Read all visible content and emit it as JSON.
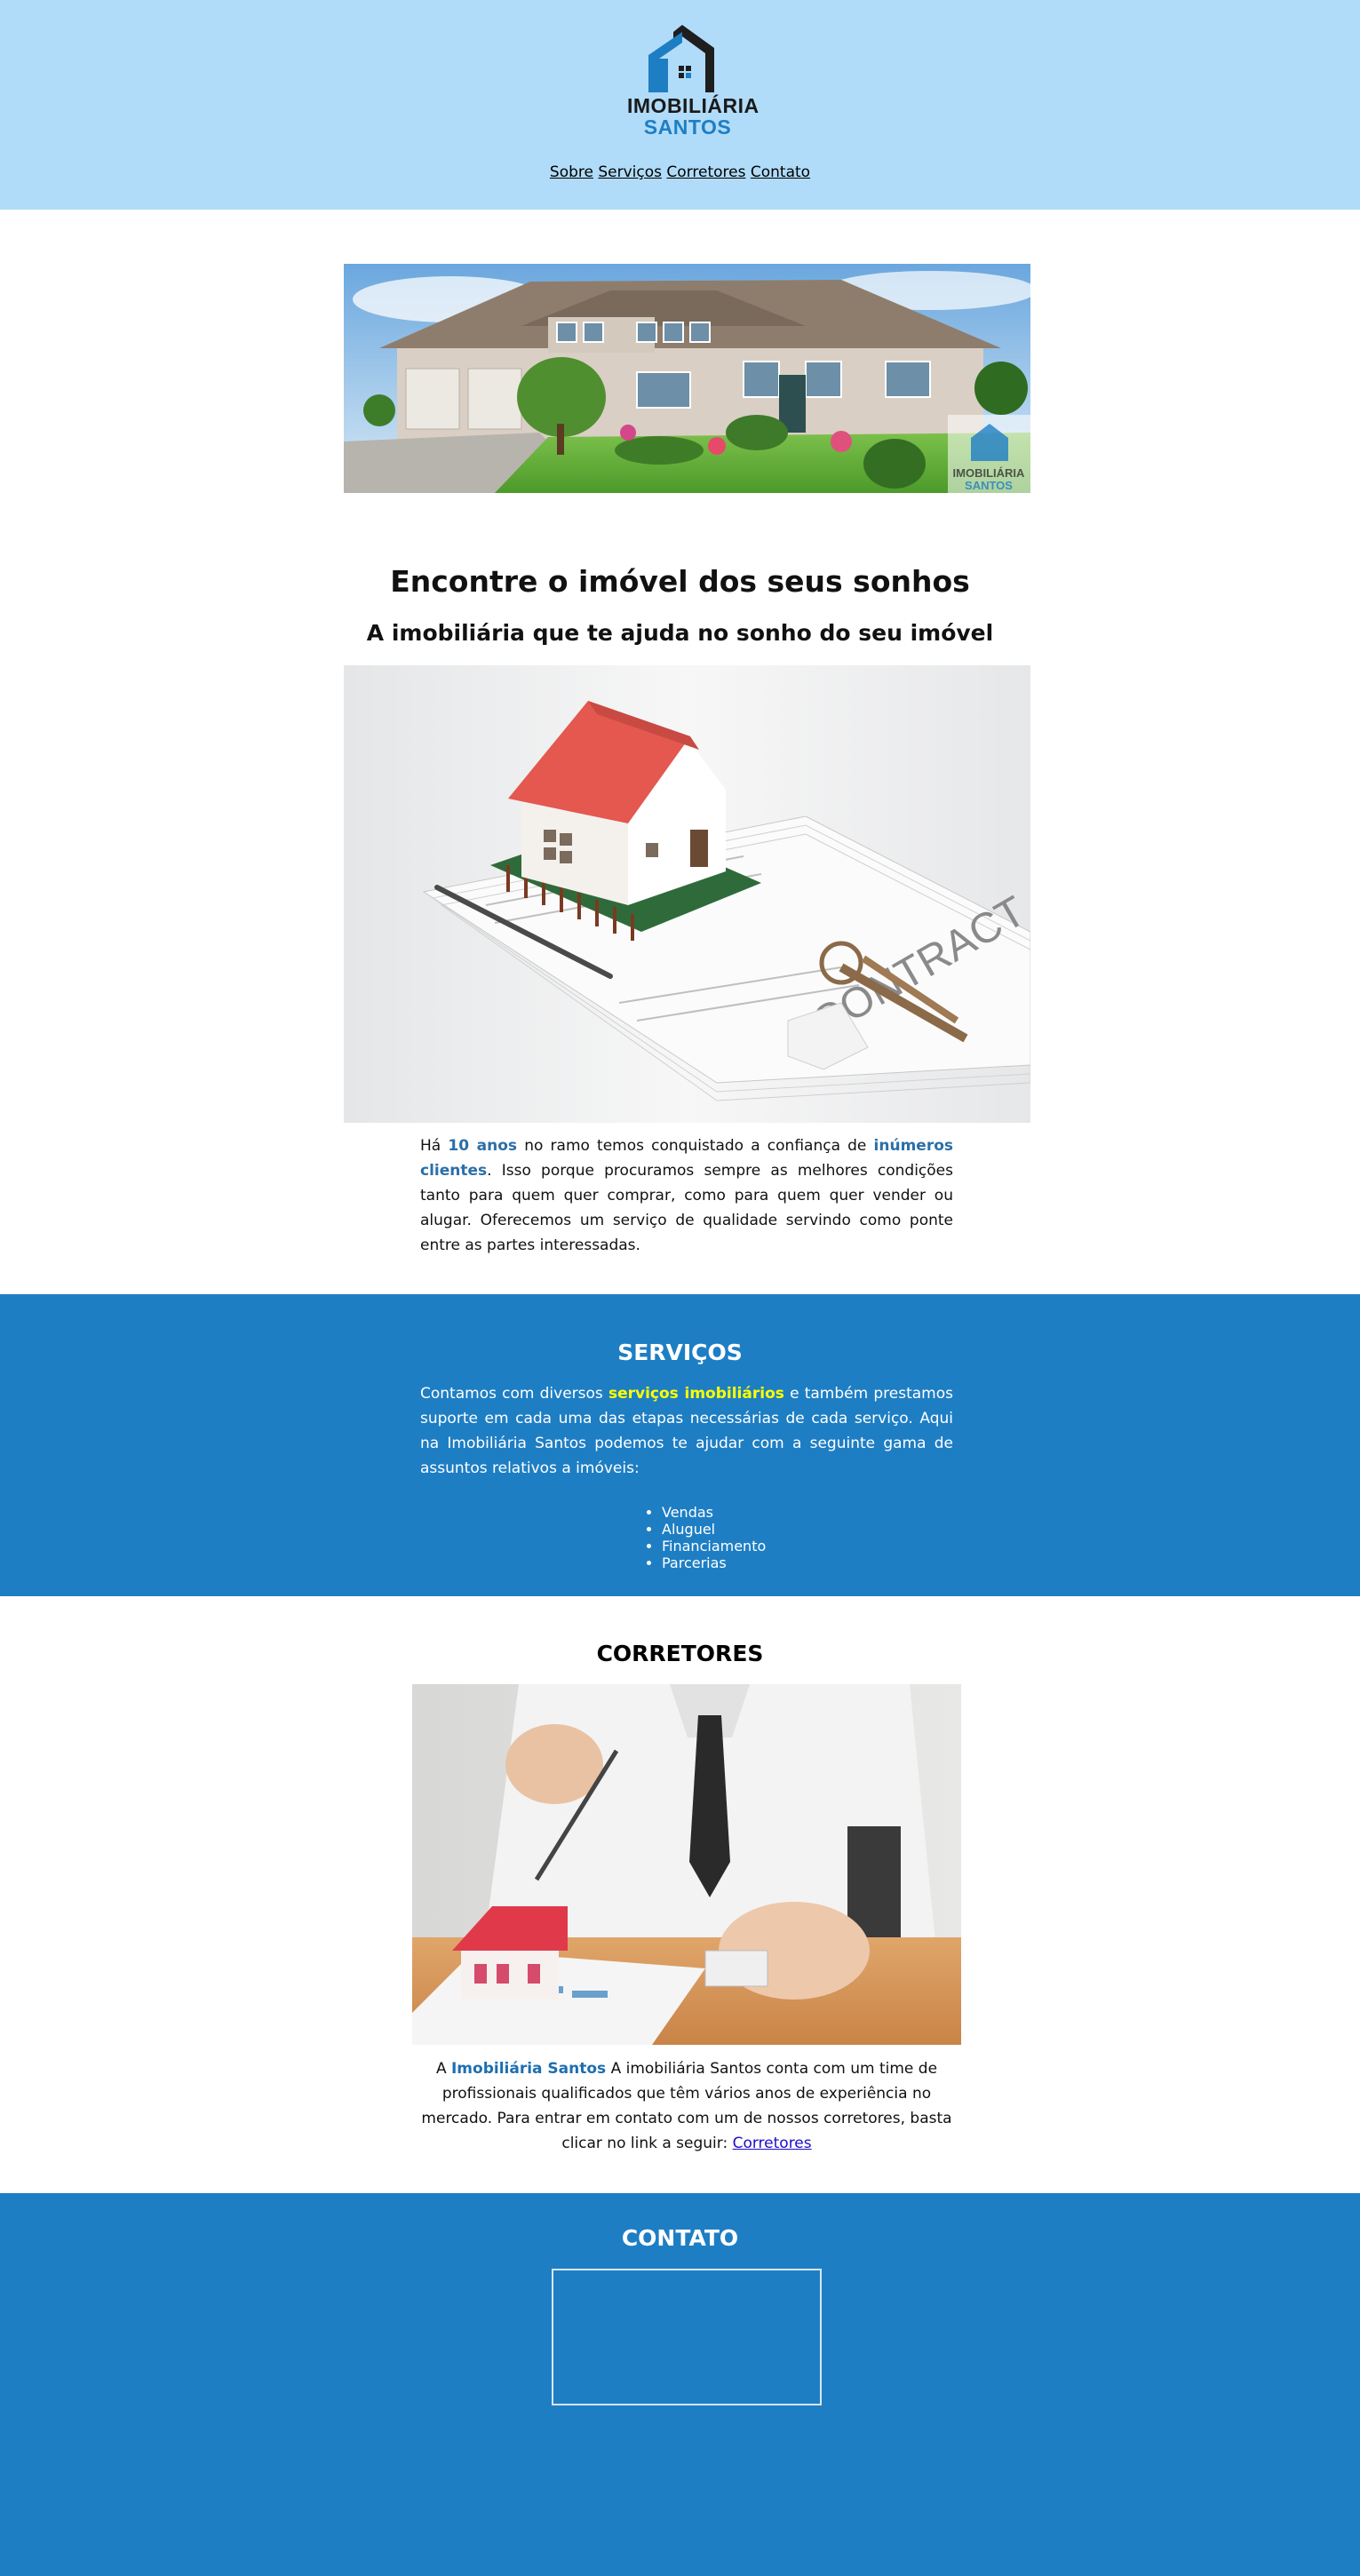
{
  "header": {
    "logo": {
      "line1": "IMOBILIÁRIA",
      "line2": "SANTOS"
    },
    "nav": [
      "Sobre",
      "Serviços",
      "Corretores",
      "Contato"
    ]
  },
  "intro": {
    "title": "Encontre o imóvel dos seus sonhos",
    "subtitle": "A imobiliária que te ajuda no sonho do seu imóvel",
    "p_1": "Há ",
    "p_hl1": "10 anos",
    "p_2": " no ramo temos conquistado a confiança de ",
    "p_hl2": "inúmeros clientes",
    "p_3": ". Isso porque procuramos sempre as melhores condições tanto para quem quer comprar, como para quem quer vender ou alugar. Oferecemos um serviço de qualidade servindo como ponte entre as partes interessadas.",
    "contract_watermark": "CONTRACT"
  },
  "servicos": {
    "title": "SERVIÇOS",
    "p_1": "Contamos com diversos ",
    "p_hl": "serviços imobiliários",
    "p_2": " e também prestamos suporte em cada uma das etapas necessárias de cada serviço. Aqui na Imobiliária Santos podemos te ajudar com a seguinte gama de assuntos relativos a imóveis:",
    "items": [
      "Vendas",
      "Aluguel",
      "Financiamento",
      "Parcerias"
    ]
  },
  "corretores": {
    "title": "CORRETORES",
    "p_1": "A ",
    "p_hl": "Imobiliária Santos",
    "p_2": " A imobiliária Santos conta com um time de profissionais qualificados que têm vários anos de experiência no mercado. Para entrar em contato com um de nossos corretores, basta clicar no link a seguir: ",
    "link": "Corretores"
  },
  "contato": {
    "title": "CONTATO"
  },
  "colors": {
    "header_bg": "#b0dcf9",
    "section_blue": "#1e7ec4",
    "highlight_yellow": "#ffff00",
    "link_blue": "#1a0dcc"
  }
}
